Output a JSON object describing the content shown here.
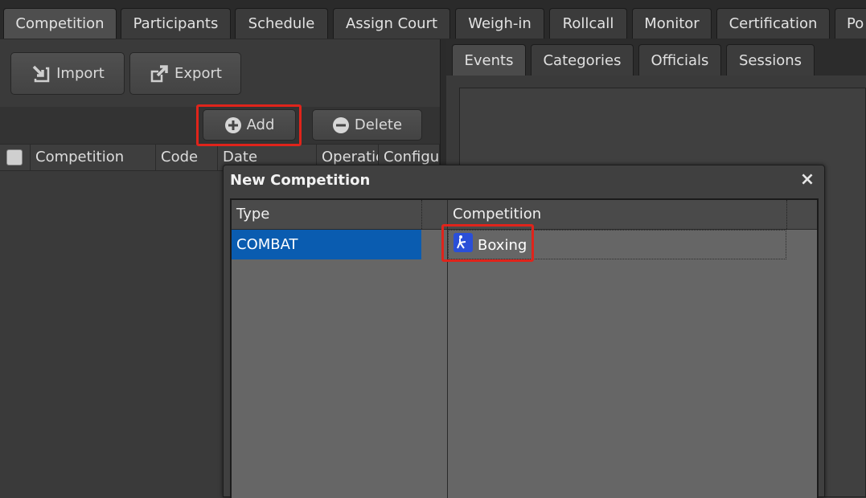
{
  "top_tabs": [
    "Competition",
    "Participants",
    "Schedule",
    "Assign Court",
    "Weigh-in",
    "Rollcall",
    "Monitor",
    "Certification",
    "Po"
  ],
  "left": {
    "import_label": "Import",
    "export_label": "Export",
    "add_label": "Add",
    "delete_label": "Delete",
    "columns": [
      "Competition",
      "Code",
      "Date",
      "Operatio",
      "Configu"
    ]
  },
  "right": {
    "tabs": [
      "Events",
      "Categories",
      "Officials",
      "Sessions"
    ]
  },
  "dialog": {
    "title": "New Competition",
    "close_label": "×",
    "columns": [
      "Type",
      "Competition"
    ],
    "type_items": [
      "COMBAT"
    ],
    "competition_items": [
      {
        "label": "Boxing",
        "icon": "boxing-icon"
      }
    ]
  },
  "colors": {
    "selected_row": "#0a5cb0",
    "highlight": "#e0241b",
    "boxing_icon_bg": "#2a4fd8"
  }
}
